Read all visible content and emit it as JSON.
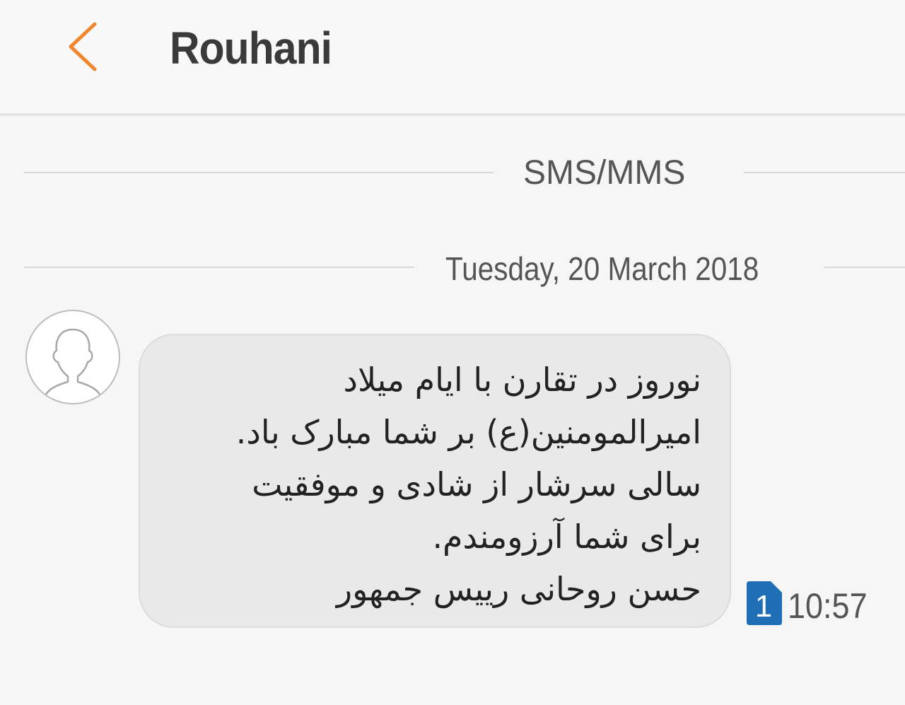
{
  "header": {
    "title": "Rouhani",
    "back_icon": "chevron-left-icon",
    "accent_color": "#f0872c"
  },
  "conversation": {
    "channel_label": "SMS/MMS",
    "date_label": "Tuesday, 20 March 2018"
  },
  "message": {
    "avatar_icon": "person-outline-icon",
    "text": "نوروز در تقارن با ایام میلاد\nامیرالمومنین(ع) بر شما مبارک باد.\nسالی سرشار از شادی و موفقیت\nبرای شما آرزومندم.\nحسن روحانی رییس جمهور",
    "sim_number": "1",
    "sim_icon": "sim-card-icon",
    "sim_color": "#1e6fb5",
    "time": "10:57"
  }
}
